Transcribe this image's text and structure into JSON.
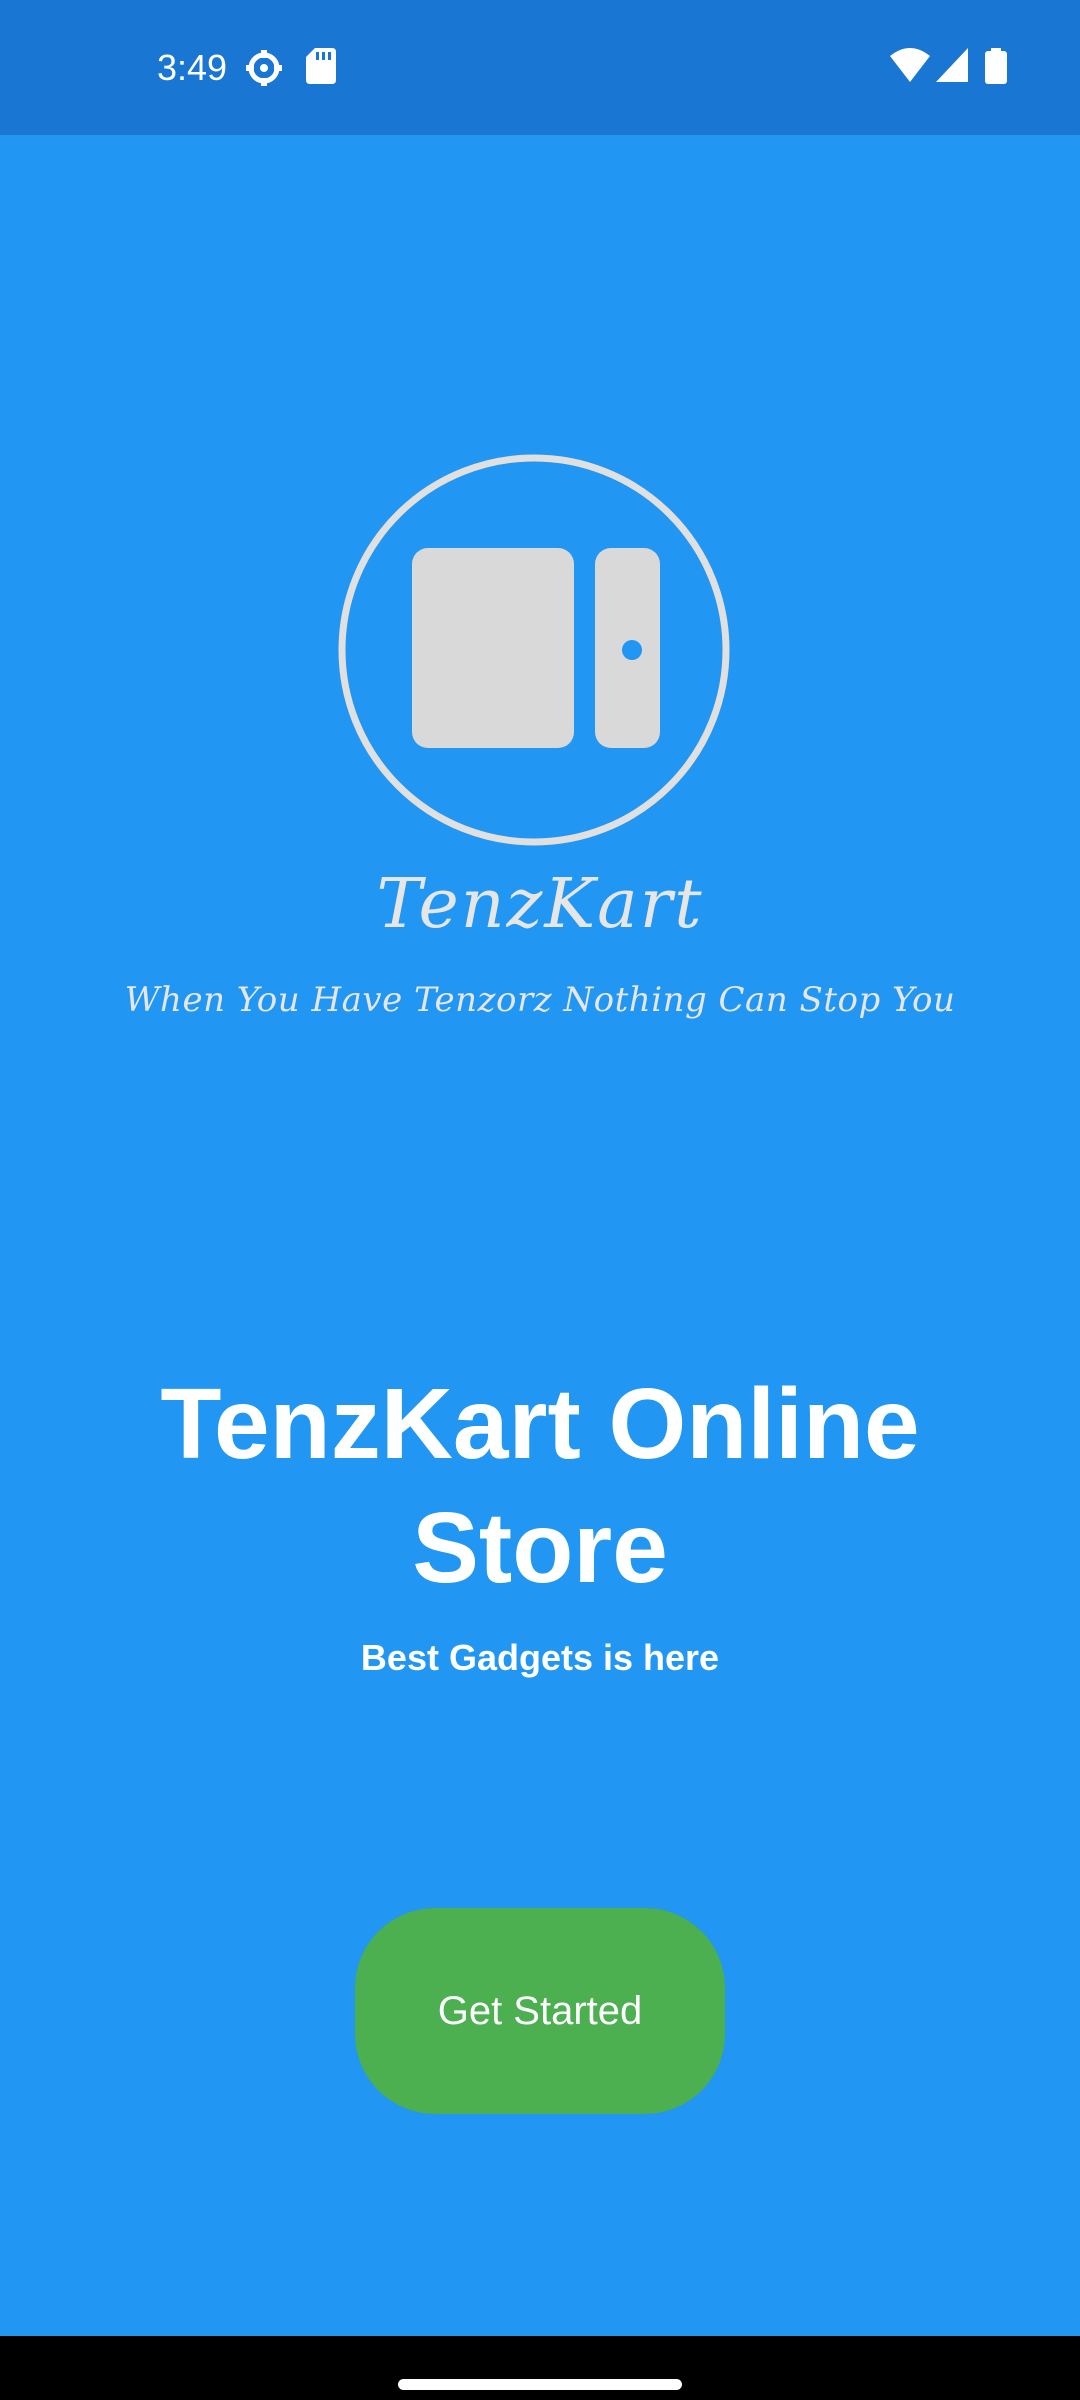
{
  "status_bar": {
    "time": "3:49",
    "icons": [
      "settings-gear-icon",
      "sd-card-icon",
      "wifi-icon",
      "cell-signal-icon",
      "battery-icon"
    ]
  },
  "logo": {
    "icon": "tablet-logo-icon",
    "brand_name": "TenzKart",
    "tagline": "When You Have Tenzorz Nothing Can Stop You"
  },
  "main": {
    "title": "TenzKart Online Store",
    "subtitle": "Best Gadgets is here",
    "cta_label": "Get Started"
  },
  "colors": {
    "background": "#2196F3",
    "status_bar": "#1976D2",
    "button": "#4CAF50",
    "logo": "#E0E0E0"
  }
}
